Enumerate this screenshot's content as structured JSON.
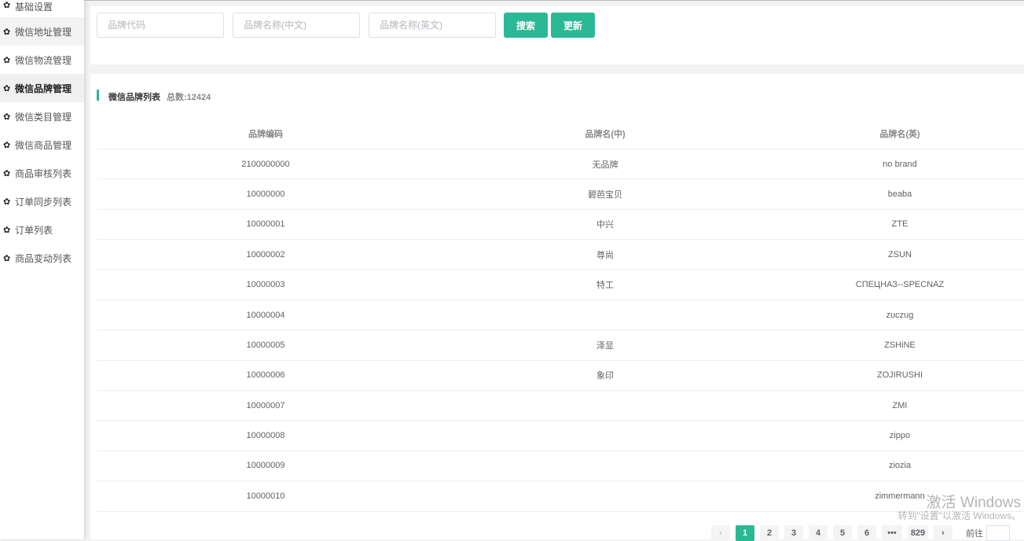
{
  "sidebar": {
    "items": [
      {
        "label": "基础设置"
      },
      {
        "label": "微信地址管理"
      },
      {
        "label": "微信物流管理"
      },
      {
        "label": "微信品牌管理"
      },
      {
        "label": "微信类目管理"
      },
      {
        "label": "微信商品管理"
      },
      {
        "label": "商品审核列表"
      },
      {
        "label": "订单同步列表"
      },
      {
        "label": "订单列表"
      },
      {
        "label": "商品变动列表"
      }
    ],
    "active": "微信品牌管理"
  },
  "search": {
    "code_placeholder": "品牌代码",
    "cn_placeholder": "品牌名称(中文)",
    "en_placeholder": "品牌名称(英文)",
    "search_label": "搜索",
    "refresh_label": "更新"
  },
  "list": {
    "title": "微信品牌列表",
    "total": "总数:12424",
    "columns": [
      "品牌编码",
      "品牌名(中)",
      "品牌名(英)"
    ],
    "rows": [
      [
        "2100000000",
        "无品牌",
        "no brand"
      ],
      [
        "10000000",
        "碧芭宝贝",
        "beaba"
      ],
      [
        "10000001",
        "中兴",
        "ZTE"
      ],
      [
        "10000002",
        "尊尚",
        "ZSUN"
      ],
      [
        "10000003",
        "特工",
        "СПЕЦНАЗ--SPECNAZ"
      ],
      [
        "10000004",
        "",
        "zuczug"
      ],
      [
        "10000005",
        "泽显",
        "ZSHiNE"
      ],
      [
        "10000006",
        "象印",
        "ZOJIRUSHI"
      ],
      [
        "10000007",
        "",
        "ZMI"
      ],
      [
        "10000008",
        "",
        "zippo"
      ],
      [
        "10000009",
        "",
        "ziozia"
      ],
      [
        "10000010",
        "",
        "zimmermann"
      ]
    ]
  },
  "pagination": {
    "pages": [
      "1",
      "2",
      "3",
      "4",
      "5",
      "6",
      "•••",
      "829"
    ],
    "current": "1",
    "prev": "‹",
    "next": "›",
    "goto_label": "前往"
  },
  "watermark": {
    "line1": "激活 Windows",
    "line2": "转到\"设置\"以激活 Windows。"
  },
  "colors": {
    "accent": "#2bb894"
  }
}
